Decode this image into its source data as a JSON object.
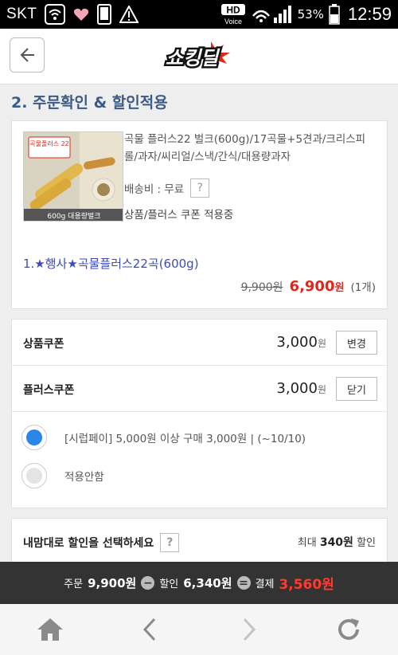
{
  "status_bar": {
    "carrier": "SKT",
    "battery": "53%",
    "time": "12:59",
    "hd_label": "HD",
    "voice_label": "Voice",
    "icons": [
      "wifi-icon",
      "heart-icon",
      "phone-icon",
      "warning-icon",
      "hd-voice-icon",
      "signal-icon",
      "battery-icon"
    ]
  },
  "header": {
    "logo_text": "쇼킹딜",
    "back_icon": "back-arrow-icon"
  },
  "section": {
    "title": "2. 주문확인 & 할인적용"
  },
  "product": {
    "title": "곡물 플러스22 벌크(600g)/17곡물+5견과/크리스피롤/과자/씨리얼/스낵/간식/대용량과자",
    "thumbnail_label": "곡물플러스 22",
    "thumbnail_caption": "600g 대용량벌크",
    "shipping_label": "배송비 : 무료",
    "help_mark": "?",
    "coupon_note": "상품/플러스 쿠폰 적용중",
    "option": "1.★행사★곡물플러스22곡(600g)",
    "original_price": "9,900원",
    "sale_price": "6,900",
    "sale_unit": "원",
    "quantity": "(1개)"
  },
  "coupons": {
    "product_coupon": {
      "label": "상품쿠폰",
      "amount": "3,000",
      "unit": "원",
      "button": "변경"
    },
    "plus_coupon": {
      "label": "플러스쿠폰",
      "amount": "3,000",
      "unit": "원",
      "button": "닫기"
    },
    "options": [
      {
        "text": "[시럽페이] 5,000원 이상 구매 3,000원 | (~10/10)",
        "selected": true
      },
      {
        "text": "적용안함",
        "selected": false
      }
    ]
  },
  "discount": {
    "label": "내맘대로 할인을 선택하세요",
    "help_mark": "?",
    "max_prefix": "최대",
    "max_value": "340원",
    "max_suffix": "할인"
  },
  "summary": {
    "order_label": "주문",
    "order_value": "9,900원",
    "minus": "−",
    "discount_label": "할인",
    "discount_value": "6,340원",
    "equals": "=",
    "pay_label": "결제",
    "pay_value": "3,560원"
  },
  "colors": {
    "accent_blue": "#3b5b86",
    "price_red": "#e1261c",
    "radio_blue": "#2a86e8",
    "summary_bg": "#333333"
  }
}
